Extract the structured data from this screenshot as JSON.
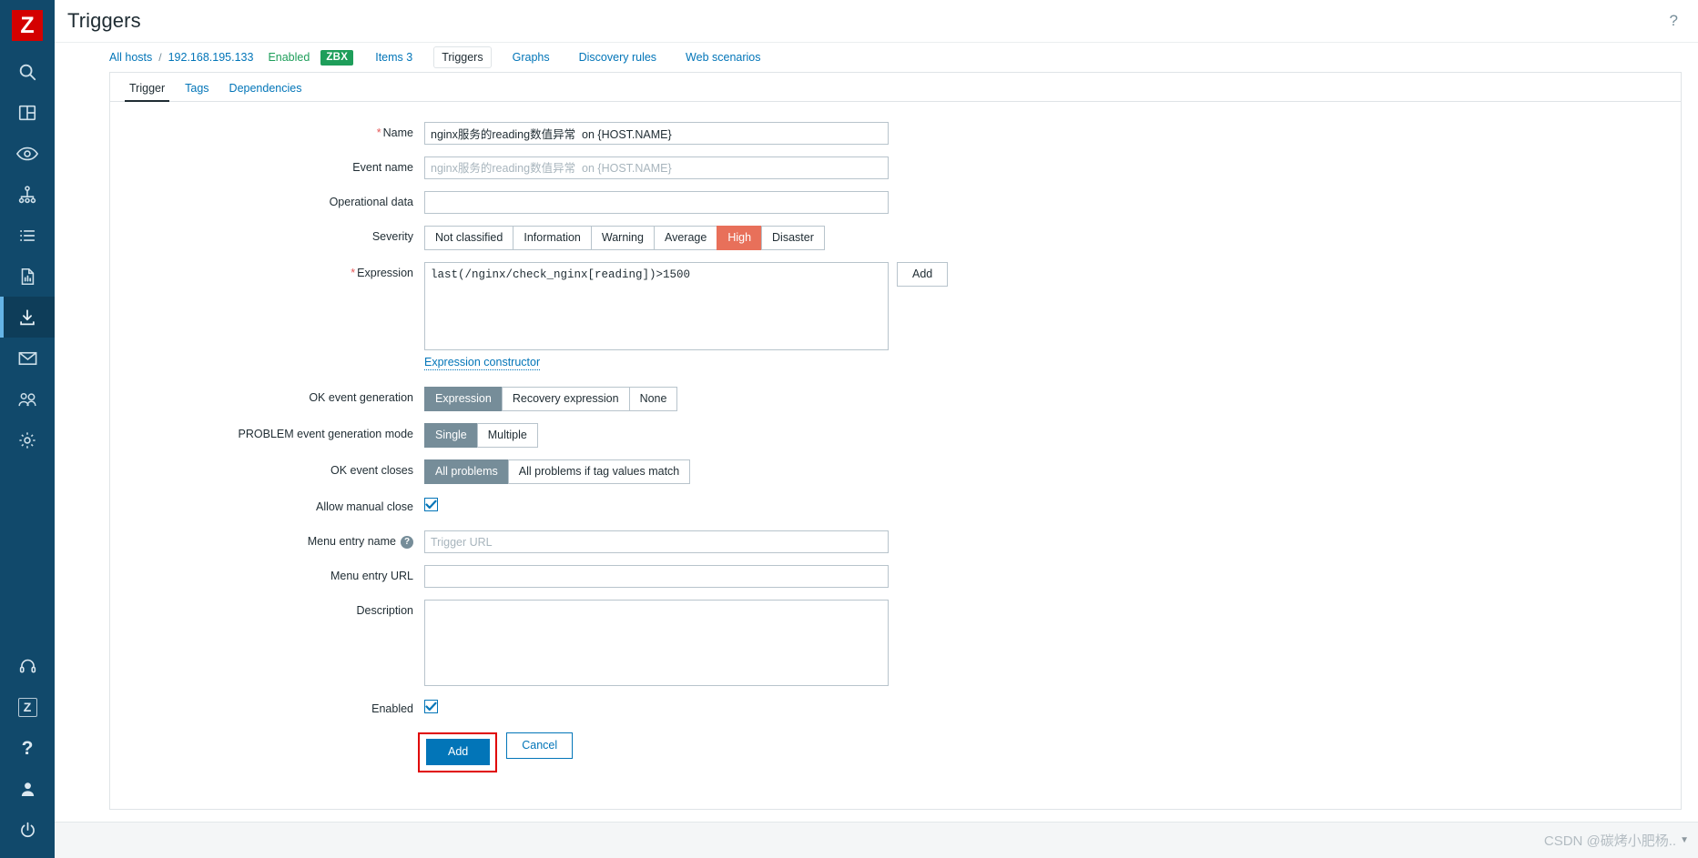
{
  "app": {
    "logo_letter": "Z",
    "page_title": "Triggers",
    "help_glyph": "?"
  },
  "sidebar": {
    "items": [
      {
        "name": "search-icon",
        "label": "Search"
      },
      {
        "name": "dashboard-icon",
        "label": "Dashboards"
      },
      {
        "name": "eye-icon",
        "label": "Monitoring"
      },
      {
        "name": "network-map-icon",
        "label": "Services"
      },
      {
        "name": "list-icon",
        "label": "Inventory"
      },
      {
        "name": "report-icon",
        "label": "Reports"
      },
      {
        "name": "download-icon",
        "label": "Data collection"
      },
      {
        "name": "mail-icon",
        "label": "Alerts"
      },
      {
        "name": "users-icon",
        "label": "Users"
      },
      {
        "name": "gear-icon",
        "label": "Administration"
      }
    ],
    "bottom_items": [
      {
        "name": "support-icon",
        "label": "Support"
      },
      {
        "name": "zabbix-logo-icon",
        "label": "Z"
      },
      {
        "name": "help-icon",
        "label": "?"
      },
      {
        "name": "user-avatar-icon",
        "label": "User settings"
      },
      {
        "name": "power-icon",
        "label": "Sign out"
      }
    ],
    "active_index": 6
  },
  "breadcrumb": {
    "all_hosts": "All hosts",
    "separator": "/",
    "host": "192.168.195.133",
    "status": "Enabled",
    "agent_badge": "ZBX",
    "tabs": [
      {
        "label": "Items 3",
        "selected": false
      },
      {
        "label": "Triggers",
        "selected": true
      },
      {
        "label": "Graphs",
        "selected": false
      },
      {
        "label": "Discovery rules",
        "selected": false
      },
      {
        "label": "Web scenarios",
        "selected": false
      }
    ]
  },
  "tabs": [
    {
      "label": "Trigger",
      "active": true
    },
    {
      "label": "Tags",
      "active": false
    },
    {
      "label": "Dependencies",
      "active": false
    }
  ],
  "form": {
    "name": {
      "label": "Name",
      "required": true,
      "value": "nginx服务的reading数值异常  on {HOST.NAME}"
    },
    "event_name": {
      "label": "Event name",
      "value": "",
      "placeholder": "nginx服务的reading数值异常  on {HOST.NAME}"
    },
    "operational_data": {
      "label": "Operational data",
      "value": "",
      "placeholder": ""
    },
    "severity": {
      "label": "Severity",
      "options": [
        "Not classified",
        "Information",
        "Warning",
        "Average",
        "High",
        "Disaster"
      ],
      "selected": "High"
    },
    "expression": {
      "label": "Expression",
      "required": true,
      "value": "last(/nginx/check_nginx[reading])>1500",
      "add_button": "Add",
      "constructor_link": "Expression constructor"
    },
    "ok_event_generation": {
      "label": "OK event generation",
      "options": [
        "Expression",
        "Recovery expression",
        "None"
      ],
      "selected": "Expression"
    },
    "problem_event_generation_mode": {
      "label": "PROBLEM event generation mode",
      "options": [
        "Single",
        "Multiple"
      ],
      "selected": "Single"
    },
    "ok_event_closes": {
      "label": "OK event closes",
      "options": [
        "All problems",
        "All problems if tag values match"
      ],
      "selected": "All problems"
    },
    "allow_manual_close": {
      "label": "Allow manual close",
      "checked": true
    },
    "menu_entry_name": {
      "label": "Menu entry name",
      "help": "?",
      "value": "",
      "placeholder": "Trigger URL"
    },
    "menu_entry_url": {
      "label": "Menu entry URL",
      "value": "",
      "placeholder": ""
    },
    "description": {
      "label": "Description",
      "value": "",
      "placeholder": ""
    },
    "enabled": {
      "label": "Enabled",
      "checked": true
    },
    "submit_button": "Add",
    "cancel_button": "Cancel"
  },
  "watermark": {
    "text": "CSDN @碳烤小肥杨..",
    "caret": "▼"
  },
  "colors": {
    "sidebar_bg": "#11496b",
    "accent_link": "#0275b8",
    "severity_high": "#e8705a",
    "segment_selected": "#768d99",
    "agent_badge": "#1e9e5a",
    "logo_red": "#d40000",
    "annotation_red": "#e00000"
  }
}
